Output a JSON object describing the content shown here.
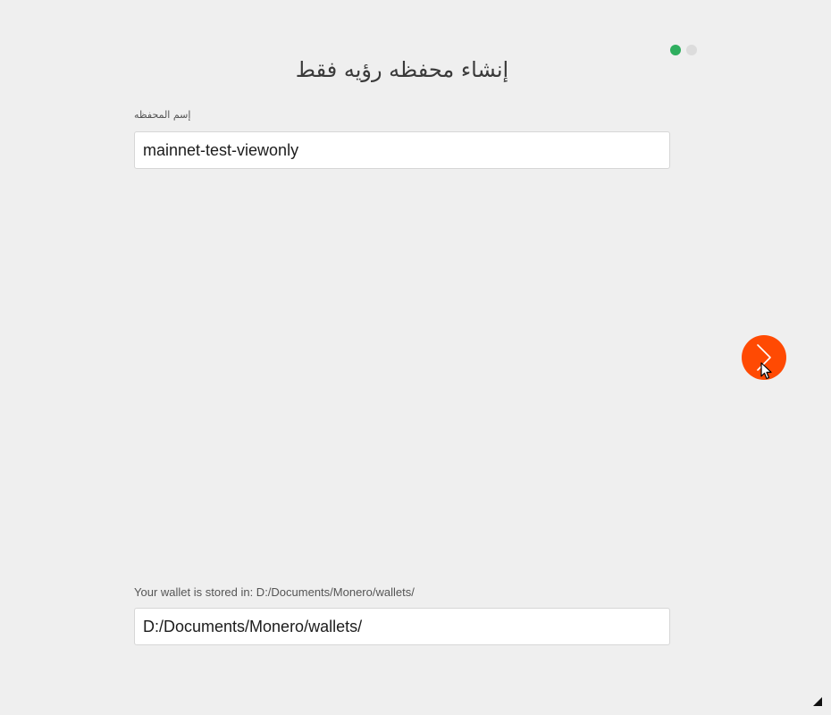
{
  "progress": {
    "total_steps": 2,
    "current_step": 1,
    "active_color": "#2eae5e",
    "inactive_color": "#dcdcdc"
  },
  "page": {
    "title": "إنشاء محفظه رؤيه فقط"
  },
  "wallet_name": {
    "label": "إسم المحفظه",
    "value": "mainnet-test-viewonly"
  },
  "wallet_location": {
    "label": "Your wallet is stored in: D:/Documents/Monero/wallets/",
    "value": "D:/Documents/Monero/wallets/"
  },
  "next_button": {
    "icon": "chevron-right-icon",
    "color": "#ff4a03"
  },
  "accent_color": "#ff4a03"
}
